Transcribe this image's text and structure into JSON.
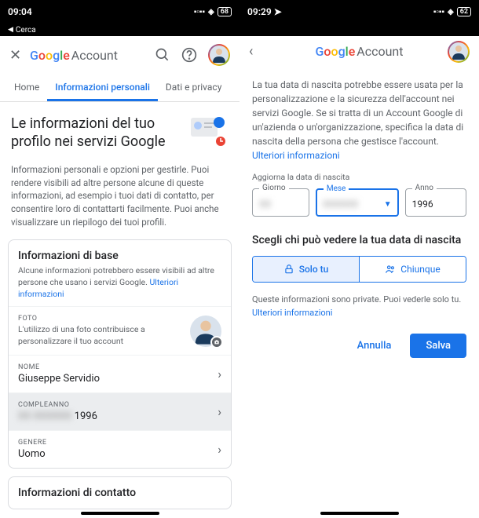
{
  "left": {
    "status": {
      "time": "09:04",
      "battery": "68",
      "search": "Cerca"
    },
    "brand": "Google",
    "brand_suffix": "Account",
    "tabs": {
      "home": "Home",
      "personal": "Informazioni personali",
      "privacy": "Dati e privacy"
    },
    "hero_title": "Le informazioni del tuo profilo nei servizi Google",
    "hero_desc": "Informazioni personali e opzioni per gestirle. Puoi rendere visibili ad altre persone alcune di queste informazioni, ad esempio i tuoi dati di contatto, per consentire loro di contattarti facilmente. Puoi anche visualizzare un riepilogo dei tuoi profili.",
    "basic": {
      "title": "Informazioni di base",
      "subtitle": "Alcune informazioni potrebbero essere visibili ad altre persone che usano i servizi Google. ",
      "link": "Ulteriori informazioni",
      "foto_label": "FOTO",
      "foto_sub": "L'utilizzo di una foto contribuisce a personalizzare il tuo account",
      "name_label": "NOME",
      "name_value": "Giuseppe Servidio",
      "bday_label": "COMPLEANNO",
      "bday_hidden": "XX XXXXXX",
      "bday_year": " 1996",
      "gender_label": "GENERE",
      "gender_value": "Uomo"
    },
    "contact_title": "Informazioni di contatto"
  },
  "right": {
    "status": {
      "time": "09:29",
      "battery": "62"
    },
    "brand": "Google",
    "brand_suffix": "Account",
    "desc": "La tua data di nascita potrebbe essere usata per la personalizzazione e la sicurezza dell'account nei servizi Google. Se si tratta di un Account Google di un'azienda o un'organizzazione, specifica la data di nascita della persona che gestisce l'account.",
    "desc_link": "Ulteriori informazioni",
    "update_label": "Aggiorna la data di nascita",
    "fields": {
      "day_label": "Giorno",
      "day_value": "XX",
      "month_label": "Mese",
      "month_value": "XXXXXX",
      "year_label": "Anno",
      "year_value": "1996"
    },
    "visibility": {
      "heading": "Scegli chi può vedere la tua data di nascita",
      "only_you": "Solo tu",
      "everyone": "Chiunque",
      "note": "Queste informazioni sono private. Puoi vederle solo tu. ",
      "note_link": "Ulteriori informazioni"
    },
    "actions": {
      "cancel": "Annulla",
      "save": "Salva"
    }
  }
}
